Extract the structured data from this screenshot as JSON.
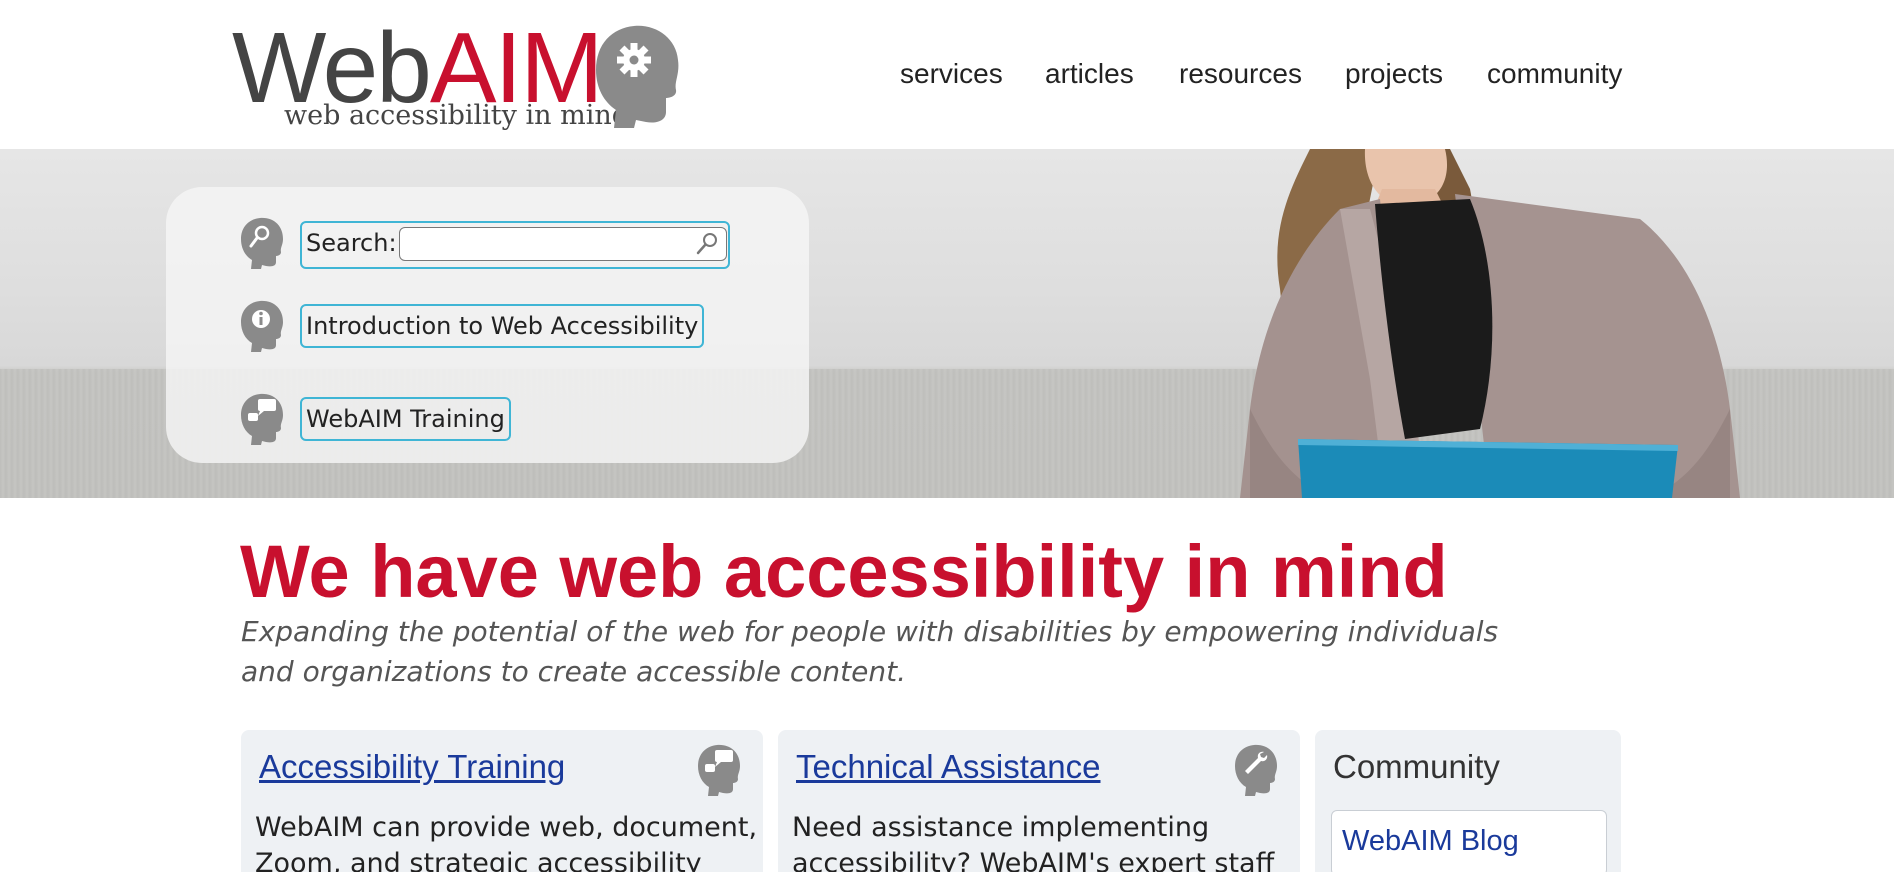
{
  "colors": {
    "brand_red": "#c8102e",
    "link_blue": "#1a3a9b",
    "focus_outline": "#3fb5d5",
    "icon_gray": "#8a8a8a"
  },
  "logo": {
    "word_web": "Web",
    "word_aim": "AIM",
    "tagline": "web accessibility in mind",
    "icon": "gear-head-icon"
  },
  "nav": {
    "items": [
      "services",
      "articles",
      "resources",
      "projects",
      "community"
    ]
  },
  "hero": {
    "search": {
      "label": "Search:",
      "value": "",
      "placeholder": "",
      "icon": "search-head-icon",
      "button_icon": "magnifier-icon"
    },
    "links": [
      {
        "label": "Introduction to Web Accessibility",
        "icon": "info-head-icon"
      },
      {
        "label": "WebAIM Training",
        "icon": "chat-head-icon"
      }
    ]
  },
  "main": {
    "headline": "We have web accessibility in mind",
    "tagline": "Expanding the potential of the web for people with disabilities by empowering individuals and organizations to create accessible content."
  },
  "cards": [
    {
      "title": "Accessibility Training",
      "icon": "chat-head-icon",
      "body_line1": "WebAIM can provide web, document,",
      "body_line2": "Zoom, and strategic accessibility"
    },
    {
      "title": "Technical Assistance",
      "icon": "wrench-head-icon",
      "body_line1": "Need assistance implementing",
      "body_line2": "accessibility? WebAIM's expert staff"
    },
    {
      "title": "Community",
      "link": "WebAIM Blog"
    }
  ]
}
